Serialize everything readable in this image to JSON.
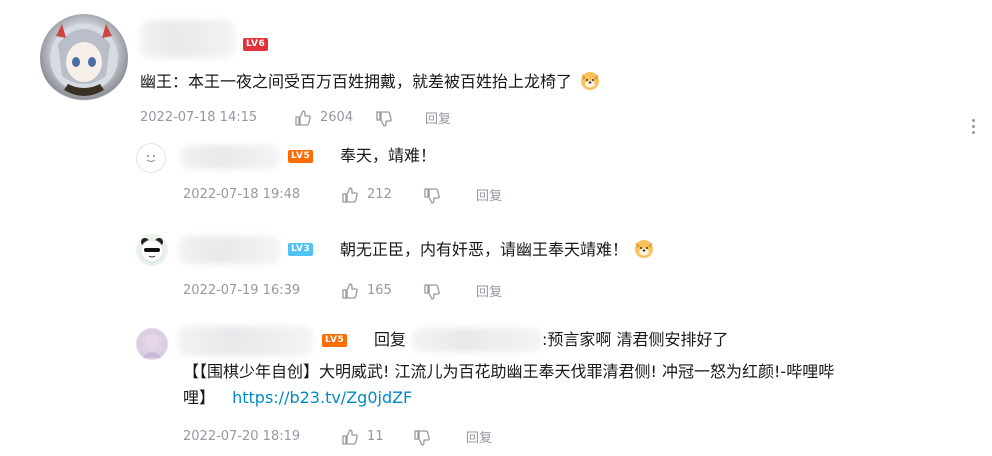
{
  "comments": [
    {
      "level": "LV6",
      "text": "幽王：本王一夜之间受百万百姓拥戴，就差被百姓抬上龙椅了",
      "emoji": "dog-emoji",
      "time": "2022-07-18 14:15",
      "likes": "2604",
      "reply_label": "回复"
    }
  ],
  "replies": [
    {
      "level": "LV5",
      "text": "奉天，靖难！",
      "time": "2022-07-18 19:48",
      "likes": "212",
      "reply_label": "回复"
    },
    {
      "level": "LV3",
      "text": "朝无正臣，内有奸恶，请幽王奉天靖难！",
      "emoji": "dog-emoji",
      "time": "2022-07-19 16:39",
      "likes": "165",
      "reply_label": "回复"
    },
    {
      "level": "LV5",
      "reply_prefix": "回复",
      "reply_suffix": ":预言家啊 清君侧安排好了",
      "line2": "【【围棋少年自创】大明威武! 江流儿为百花助幽王奉天伐罪清君侧! 冲冠一怒为红颜!-哔哩哔",
      "line3_text": "哩】",
      "link": "https://b23.tv/Zg0jdZF",
      "time": "2022-07-20 18:19",
      "likes": "11",
      "reply_label": "回复"
    }
  ],
  "colors": {
    "text": "#18191c",
    "meta": "#9499a0",
    "link": "#008ac5",
    "lv6": "#e3333a",
    "lv5": "#ff6c00",
    "lv3": "#4fc3f7"
  }
}
